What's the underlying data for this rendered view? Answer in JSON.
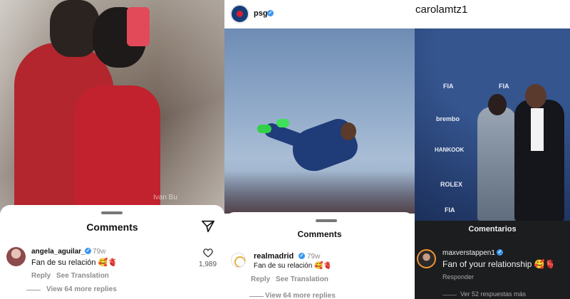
{
  "panel1": {
    "photo": {
      "watermark": "Ivan Bu"
    },
    "sheet": {
      "title": "Comments",
      "comment": {
        "username": "angela_aguilar_",
        "verified": "✓",
        "time": "79w",
        "text": "Fan de su relación",
        "emoji": "🥰🫀",
        "reply": "Reply",
        "translate": "See Translation",
        "likes": "1,989"
      },
      "more_replies": "View 64 more replies"
    }
  },
  "panel2": {
    "account": {
      "name": "psg",
      "verified": "✓"
    },
    "sheet": {
      "title": "Comments",
      "comment": {
        "username": "realmadrid",
        "verified": "✓",
        "time": "79w",
        "text": "Fan de su relación",
        "emoji": "🥰🫀",
        "reply": "Reply",
        "translate": "See Translation"
      },
      "more_replies": "View 64 more replies"
    }
  },
  "panel3": {
    "account": {
      "name": "carolamtz1"
    },
    "sponsors": [
      "FIA",
      "FIA",
      "brembo",
      "HANKOOK",
      "ROLEX",
      "FIA"
    ],
    "sheet": {
      "title": "Comentarios",
      "comment": {
        "username": "maxverstappen1",
        "verified": "✓",
        "text": "Fan of your relationship",
        "emoji": "🥰🫀",
        "reply": "Responder"
      },
      "more_replies": "Ver 52 respuestas más"
    }
  }
}
